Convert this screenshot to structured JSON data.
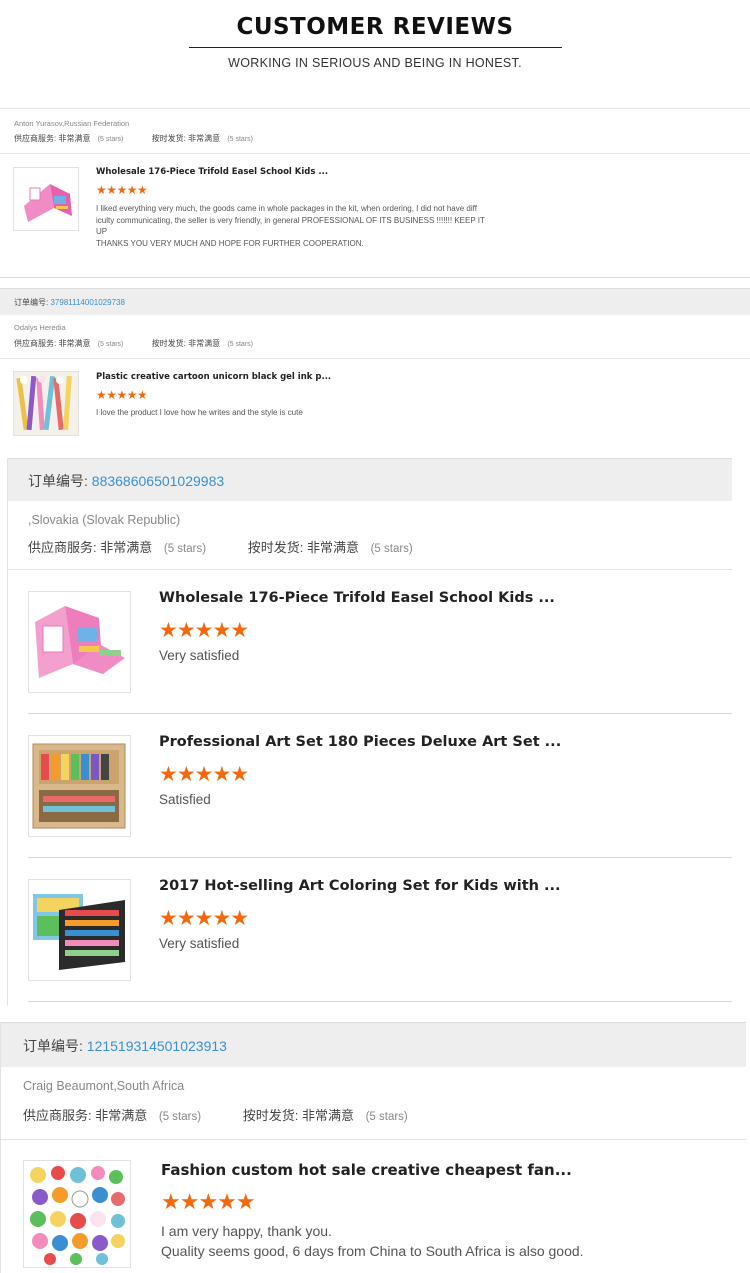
{
  "header": {
    "title": "CUSTOMER REVIEWS",
    "subtitle": "WORKING IN SERIOUS AND BEING IN HONEST."
  },
  "stars_glyph": "★★★★★",
  "colors": {
    "star": "#f26a10",
    "link": "#3a8fd1",
    "bar": "#eeeeee"
  },
  "review1": {
    "reviewer": "Anton Yurasov,Russian Federation",
    "supplier_label": "供应商服务:",
    "supplier_value": "非常满意",
    "supplier_stars": "(5 stars)",
    "ship_label": "按时发货:",
    "ship_value": "非常满意",
    "ship_stars": "(5 stars)",
    "product_title": "Wholesale 176-Piece Trifold Easel School Kids ...",
    "comment_l1": "I liked everything very much, the goods came in whole packages in the kit, when ordering, I did not have diff",
    "comment_l2": "iculty communicating, the seller is very friendly, in general PROFESSIONAL OF ITS BUSINESS !!!!!!! KEEP IT",
    "comment_l3": "UP",
    "comment_l4": "THANKS YOU VERY MUCH AND HOPE FOR FURTHER COOPERATION."
  },
  "review2": {
    "order_label": "订单编号:",
    "order_no": "37981114001029738",
    "reviewer": "Odalys Heredia",
    "supplier_label": "供应商服务:",
    "supplier_value": "非常满意",
    "supplier_stars": "(5 stars)",
    "ship_label": "按时发货:",
    "ship_value": "非常满意",
    "ship_stars": "(5 stars)",
    "product_title": "Plastic creative cartoon unicorn black gel ink p...",
    "comment": "I love the product I love how he writes and the style is cute"
  },
  "review3": {
    "order_label": "订单编号:",
    "order_no": "88368606501029983",
    "reviewer": ",Slovakia (Slovak Republic)",
    "supplier_label": "供应商服务:",
    "supplier_value": "非常满意",
    "supplier_stars": "(5 stars)",
    "ship_label": "按时发货:",
    "ship_value": "非常满意",
    "ship_stars": "(5 stars)",
    "items": [
      {
        "title": "Wholesale 176-Piece Trifold Easel School Kids ...",
        "comment": "Very satisfied"
      },
      {
        "title": "Professional Art Set 180 Pieces Deluxe Art Set ...",
        "comment": "Satisfied"
      },
      {
        "title": "2017 Hot-selling Art Coloring Set for Kids with ...",
        "comment": "Very satisfied"
      }
    ]
  },
  "review4": {
    "order_label": "订单编号:",
    "order_no": "121519314501023913",
    "reviewer": "Craig Beaumont,South Africa",
    "supplier_label": "供应商服务:",
    "supplier_value": "非常满意",
    "supplier_stars": "(5 stars)",
    "ship_label": "按时发货:",
    "ship_value": "非常满意",
    "ship_stars": "(5 stars)",
    "product_title": "Fashion custom hot sale creative cheapest fan...",
    "comment_l1": "I am very happy, thank you.",
    "comment_l2": "Quality seems good, 6 days from China to South Africa is also good."
  }
}
